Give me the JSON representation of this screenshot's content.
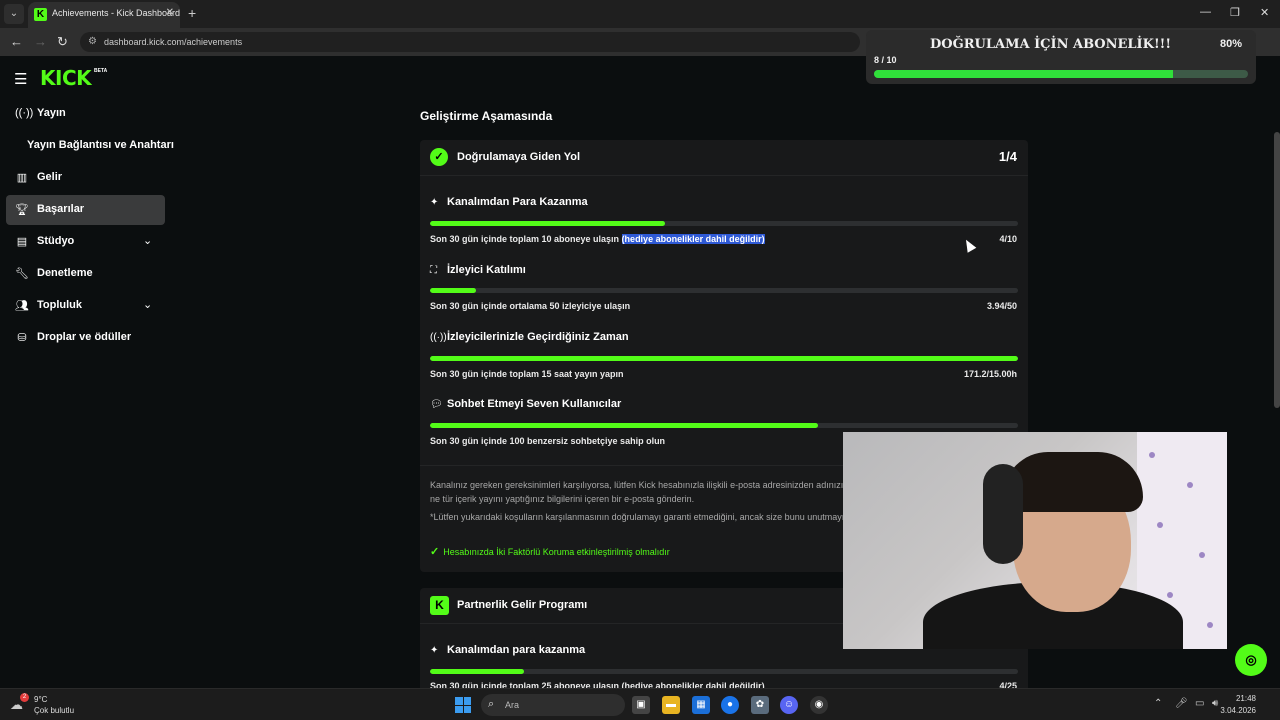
{
  "browser": {
    "tab_title": "Achievements - Kick Dashboard",
    "url": "dashboard.kick.com/achievements"
  },
  "goal_overlay": {
    "title": "DOĞRULAMA İÇİN ABONELİK!!!",
    "percent": "80%",
    "count": "8 / 10",
    "progress": 0.8
  },
  "logo": {
    "text": "KICK",
    "beta": "BETA"
  },
  "sidebar": {
    "items": [
      {
        "label": "Yayın",
        "icon": "broadcast-icon"
      },
      {
        "label": "Yayın Bağlantısı ve Anahtarı",
        "icon": ""
      },
      {
        "label": "Gelir",
        "icon": "chart-icon"
      },
      {
        "label": "Başarılar",
        "icon": "trophy-icon"
      },
      {
        "label": "Stüdyo",
        "icon": "studio-icon"
      },
      {
        "label": "Denetleme",
        "icon": "wrench-icon"
      },
      {
        "label": "Topluluk",
        "icon": "community-icon"
      },
      {
        "label": "Droplar ve ödüller",
        "icon": "drops-icon"
      }
    ]
  },
  "main": {
    "section_title": "Geliştirme Aşamasında",
    "verification_card": {
      "title": "Doğrulamaya Giden Yol",
      "count": "1/4",
      "requirements": [
        {
          "title": "Kanalımdan Para Kazanma",
          "desc": "Son 30 gün içinde toplam 10 aboneye ulaşın",
          "desc_highlight": "(hediye abonelikler dahil değildir)",
          "value": "4/10",
          "progress": 0.4
        },
        {
          "title": "İzleyici Katılımı",
          "desc": "Son 30 gün içinde ortalama 50 izleyiciye ulaşın",
          "value": "3.94/50",
          "progress": 0.079
        },
        {
          "title": "İzleyicilerinizle Geçirdiğiniz Zaman",
          "desc": "Son 30 gün içinde toplam 15 saat yayın yapın",
          "value": "171.2/15.00h",
          "progress": 1.0
        },
        {
          "title": "Sohbet Etmeyi Seven Kullanıcılar",
          "desc": "Son 30 gün içinde 100 benzersiz sohbetçiye sahip olun",
          "value": "",
          "progress": 0.66
        }
      ],
      "info_1": "Kanalınız gereken gereksinimleri karşılıyorsa, lütfen Kick hesabınızla ilişkili e-posta adresinizden adınızı ve ne tür içerik yayını yaptığınız bilgilerini içeren bir e-posta gönderin.",
      "info_2": "*Lütfen yukarıdaki koşulların karşılanmasının doğrulamayı garanti etmediğini, ancak size bunu unutmayın.",
      "check": "Hesabınızda İki Faktörlü Koruma etkinleştirilmiş olmalıdır"
    },
    "partner_card": {
      "title": "Partnerlik Gelir Programı",
      "requirement_title": "Kanalımdan para kazanma",
      "desc": "Son 30 gün içinde toplam 25 aboneye ulaşın (hediye abonelikler dahil değildir)",
      "value": "4/25",
      "progress": 0.16
    }
  },
  "taskbar": {
    "weather_badge": "2",
    "temp": "9°C",
    "weather_desc": "Çok bulutlu",
    "search_placeholder": "Ara",
    "time": "21:48",
    "date": "3.04.2026"
  },
  "colors": {
    "kick_green": "#53fc18",
    "highlight": "#2f5ad6"
  }
}
